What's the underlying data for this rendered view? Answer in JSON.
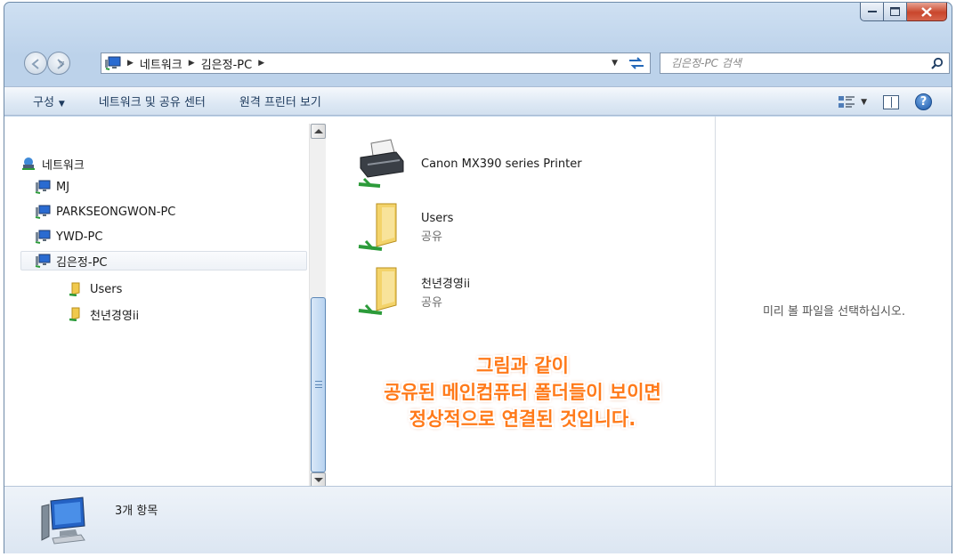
{
  "address": {
    "crumbs": [
      "네트워크",
      "김은정-PC"
    ],
    "search_placeholder": "김은정-PC 검색"
  },
  "commands": {
    "organize": "구성",
    "network_center": "네트워크 및 공유 센터",
    "remote_printers": "원격 프린터 보기"
  },
  "tree": {
    "root": "네트워크",
    "computers": [
      "MJ",
      "PARKSEONGWON-PC",
      "YWD-PC",
      "김은정-PC"
    ],
    "shares": [
      "Users",
      "천년경영ii"
    ]
  },
  "files": [
    {
      "name": "Canon MX390 series Printer",
      "sub": ""
    },
    {
      "name": "Users",
      "sub": "공유"
    },
    {
      "name": "천년경영ii",
      "sub": "공유"
    }
  ],
  "annotation": {
    "line1": "그림과 같이",
    "line2": "공유된 메인컴퓨터 폴더들이 보이면",
    "line3": "정상적으로 연결된 것입니다."
  },
  "preview_message": "미리 볼 파일을 선택하십시오.",
  "details": {
    "item_count": "3개 항목"
  },
  "colors": {
    "annotation": "#ff7a1a",
    "command_text": "#1e3b5e",
    "close_button": "#c9462c"
  }
}
